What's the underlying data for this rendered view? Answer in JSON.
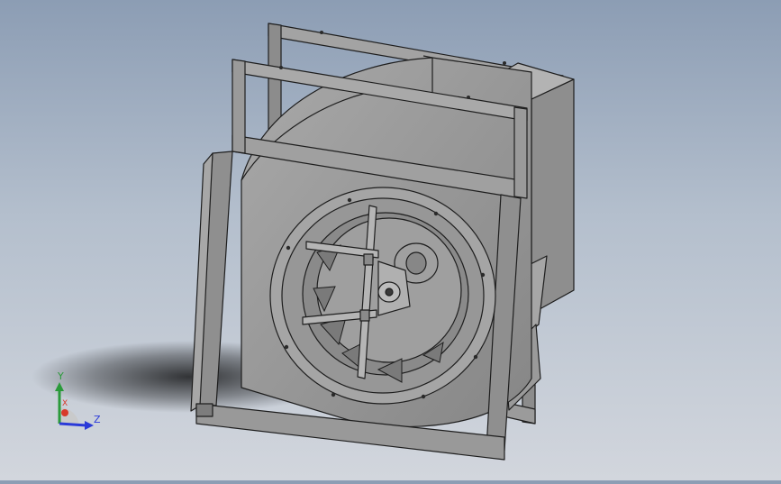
{
  "colors": {
    "background_top": "#8c9db4",
    "background_bottom": "#d2d6dd",
    "model_fill": "#9a9a9a",
    "model_dark": "#6e6e6e",
    "model_light": "#b8b8b8",
    "edge": "#1e1e1e",
    "axis_x": "#d83a2a",
    "axis_y": "#2a9a3a",
    "axis_z": "#2a3ad8"
  },
  "icons": {
    "model": "centrifugal-fan-3d-model-icon",
    "triad": "coordinate-triad-icon"
  },
  "triad": {
    "x_label": "X",
    "y_label": "Y",
    "z_label": "Z"
  }
}
